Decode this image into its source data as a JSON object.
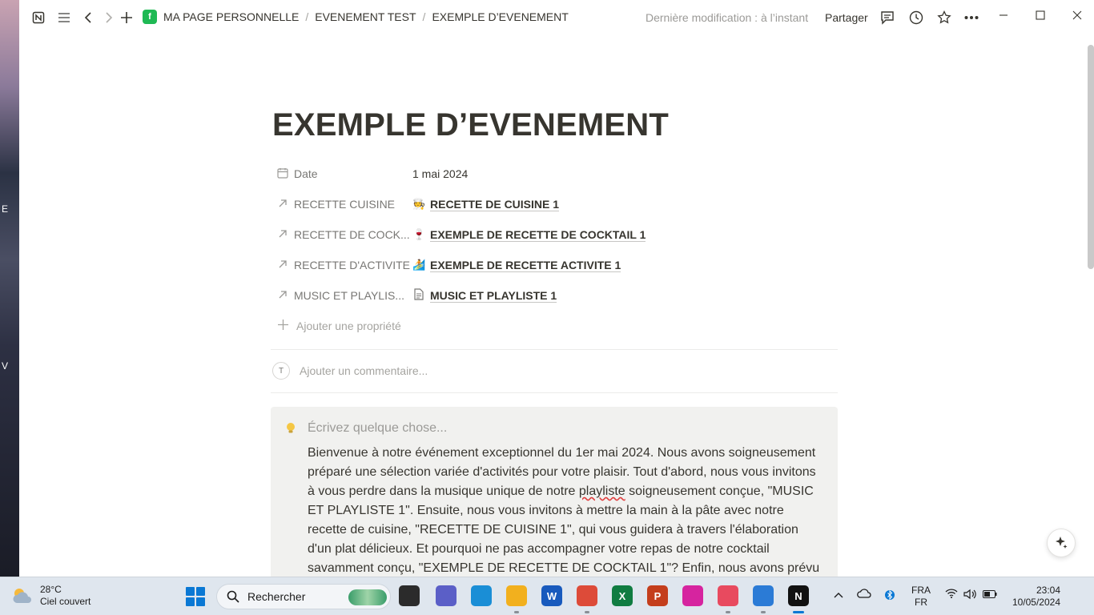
{
  "desktop": {
    "fragments": [
      "E",
      "V"
    ]
  },
  "titlebar": {
    "breadcrumbs": [
      "MA PAGE PERSONNELLE",
      "EVENEMENT TEST",
      "EXEMPLE D’EVENEMENT"
    ],
    "separator": "/",
    "last_modified": "Dernière modification : à l’instant",
    "share_label": "Partager"
  },
  "page": {
    "title": "EXEMPLE D’EVENEMENT",
    "properties": [
      {
        "icon": "calendar-icon",
        "name": "Date",
        "value": "1 mai 2024"
      },
      {
        "icon": "relation-arrow-icon",
        "name": "RECETTE CUISINE",
        "emoji": "🧑‍🍳",
        "value": "RECETTE DE CUISINE 1"
      },
      {
        "icon": "relation-arrow-icon",
        "name": "RECETTE DE COCK...",
        "emoji": "🍷",
        "value": "EXEMPLE DE RECETTE DE COCKTAIL 1"
      },
      {
        "icon": "relation-arrow-icon",
        "name": "RECETTE D'ACTIVITE",
        "emoji": "🏄",
        "value": "EXEMPLE DE RECETTE ACTIVITE 1"
      },
      {
        "icon": "relation-arrow-icon",
        "name": "MUSIC ET PLAYLIS...",
        "emoji": "🗋",
        "value": "MUSIC ET PLAYLISTE 1"
      }
    ],
    "add_property": "Ajouter une propriété",
    "comment": {
      "avatar_initial": "T",
      "placeholder": "Ajouter un commentaire..."
    },
    "callout": {
      "placeholder": "Écrivez quelque chose...",
      "body_before": "Bienvenue à notre événement exceptionnel du 1er mai 2024. Nous avons soigneusement préparé une sélection variée d'activités pour votre plaisir. Tout d'abord, nous vous invitons à vous perdre dans la musique unique de notre ",
      "body_misspelled": "playliste",
      "body_after": " soigneusement conçue, \"MUSIC ET PLAYLISTE 1\". Ensuite, nous vous invitons à mettre la main à la pâte avec notre recette de cuisine, \"RECETTE DE CUISINE 1\", qui vous guidera à travers l'élaboration d'un plat délicieux. Et pourquoi ne pas accompagner votre repas de notre cocktail savamment conçu, \"EXEMPLE DE RECETTE DE COCKTAIL 1\"? Enfin, nous avons prévu une activité"
    }
  },
  "taskbar": {
    "weather": {
      "temp": "28°C",
      "condition": "Ciel couvert"
    },
    "search_label": "Rechercher",
    "apps": [
      {
        "name": "task-view",
        "label": "",
        "color": "#2b2b2b"
      },
      {
        "name": "teams",
        "label": "",
        "color": "#5b5fc7"
      },
      {
        "name": "edge",
        "label": "",
        "color": "#1a8ed6"
      },
      {
        "name": "file-explorer",
        "label": "",
        "color": "#f2b01e"
      },
      {
        "name": "word",
        "label": "W",
        "color": "#185abd"
      },
      {
        "name": "chrome",
        "label": "",
        "color": "#dd4b39"
      },
      {
        "name": "excel",
        "label": "X",
        "color": "#107c41"
      },
      {
        "name": "powerpoint",
        "label": "P",
        "color": "#c43e1c"
      },
      {
        "name": "instagram",
        "label": "",
        "color": "#d6249f"
      },
      {
        "name": "snipping-tool",
        "label": "",
        "color": "#e84a5f"
      },
      {
        "name": "photos",
        "label": "",
        "color": "#2b7bd6"
      },
      {
        "name": "notion",
        "label": "N",
        "color": "#111111"
      }
    ],
    "language": {
      "line1": "FRA",
      "line2": "FR"
    },
    "clock": {
      "time": "23:04",
      "date": "10/05/2024"
    }
  },
  "colors": {
    "accent": "#0a78d4",
    "callout_bg": "#f1f1ef",
    "logo_green": "#1fb954"
  }
}
